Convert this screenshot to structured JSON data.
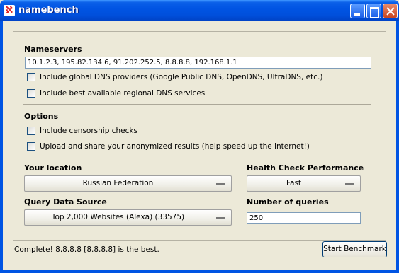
{
  "window": {
    "title": "namebench",
    "icon_glyph": "ℵ",
    "controls": [
      "minimize-icon",
      "maximize-icon",
      "close-icon"
    ]
  },
  "nameservers": {
    "heading": "Nameservers",
    "value": "10.1.2.3, 195.82.134.6, 91.202.252.5, 8.8.8.8, 192.168.1.1",
    "global_label": "Include global DNS providers (Google Public DNS, OpenDNS, UltraDNS, etc.)",
    "global_checked": false,
    "regional_label": "Include best available regional DNS services",
    "regional_checked": false
  },
  "options": {
    "heading": "Options",
    "censorship_label": "Include censorship checks",
    "censorship_checked": false,
    "upload_label": "Upload and share your anonymized results (help speed up the internet!)",
    "upload_checked": false
  },
  "location": {
    "heading": "Your location",
    "selected": "Russian Federation"
  },
  "health": {
    "heading": "Health Check Performance",
    "selected": "Fast"
  },
  "query_source": {
    "heading": "Query Data Source",
    "selected": "Top 2,000 Websites (Alexa) (33575)"
  },
  "num_queries": {
    "heading": "Number of queries",
    "value": "250"
  },
  "status": {
    "text": "Complete! 8.8.8.8 [8.8.8.8] is the best."
  },
  "actions": {
    "start_label": "Start Benchmark"
  }
}
